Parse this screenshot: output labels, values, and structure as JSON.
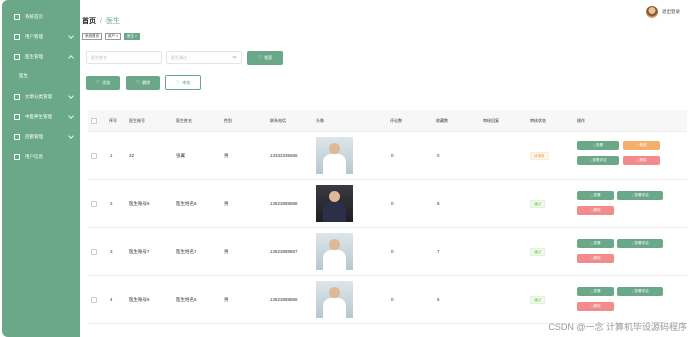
{
  "sidebar": {
    "items": [
      {
        "label": "系统首页"
      },
      {
        "label": "用户管理"
      },
      {
        "label": "医生管理"
      },
      {
        "label": "医生"
      },
      {
        "label": "文章分类管理"
      },
      {
        "label": "中医养生管理"
      },
      {
        "label": "后勤管理"
      },
      {
        "label": "用户信息"
      }
    ]
  },
  "header": {
    "breadcrumb_home": "首页",
    "breadcrumb_current": "医生",
    "username": "退出登录"
  },
  "tabs": [
    "系统首页",
    "用户 ×",
    "医生 ×"
  ],
  "filters": {
    "doctor_name_placeholder": "医生姓名",
    "review_placeholder": "医生通过",
    "search_label": "搜索"
  },
  "toolbar": {
    "add_label": "添加",
    "delete_label": "删除",
    "review_label": "审核"
  },
  "table": {
    "headers": [
      "序号",
      "医生账号",
      "医生姓名",
      "性别",
      "联系电话",
      "头像",
      "评论数",
      "收藏数",
      "审核回复",
      "审核状态",
      "操作"
    ],
    "rows": [
      {
        "index": "1",
        "account": "22",
        "name": "张翼",
        "gender": "男",
        "phone": "13333336665",
        "comments": "0",
        "favorites": "0",
        "status": "待审核",
        "status_type": "pend"
      },
      {
        "index": "2",
        "account": "医生账号8",
        "name": "医生姓名8",
        "gender": "男",
        "phone": "13823888888",
        "comments": "0",
        "favorites": "8",
        "status": "通过",
        "status_type": "ok"
      },
      {
        "index": "3",
        "account": "医生账号7",
        "name": "医生姓名7",
        "gender": "男",
        "phone": "13823888887",
        "comments": "0",
        "favorites": "7",
        "status": "通过",
        "status_type": "ok"
      },
      {
        "index": "4",
        "account": "医生账号6",
        "name": "医生姓名6",
        "gender": "男",
        "phone": "13823888886",
        "comments": "0",
        "favorites": "6",
        "status": "通过",
        "status_type": "ok"
      }
    ],
    "actions": {
      "view": "查看",
      "edit": "修改",
      "view_comments": "查看评论",
      "delete": "删除"
    }
  },
  "watermark": "CSDN @一念 计算机毕设源码程序",
  "colors": {
    "accent": "#6aa889",
    "warn": "#f4b06a",
    "danger": "#f28b8b"
  }
}
